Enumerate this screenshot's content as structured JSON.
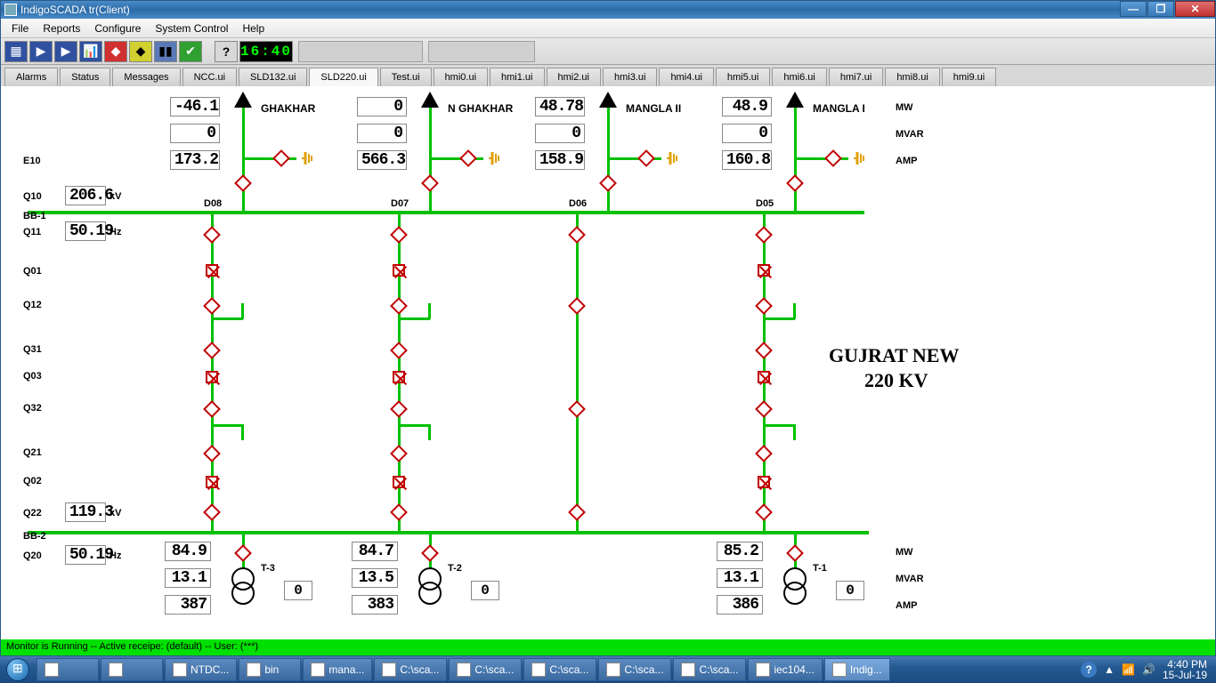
{
  "window": {
    "title": "IndigoSCADA tr(Client)"
  },
  "menu": [
    "File",
    "Reports",
    "Configure",
    "System Control",
    "Help"
  ],
  "toolbar": {
    "clock": "16:40"
  },
  "tabs": [
    "Alarms",
    "Status",
    "Messages",
    "NCC.ui",
    "SLD132.ui",
    "SLD220.ui",
    "Test.ui",
    "hmi0.ui",
    "hmi1.ui",
    "hmi2.ui",
    "hmi3.ui",
    "hmi4.ui",
    "hmi5.ui",
    "hmi6.ui",
    "hmi7.ui",
    "hmi8.ui",
    "hmi9.ui"
  ],
  "active_tab": "SLD220.ui",
  "feeders": [
    {
      "name": "GHAKHAR",
      "bay": "D08",
      "mw": "-46.1",
      "mvar": "0",
      "amp": "173.2"
    },
    {
      "name": "N GHAKHAR",
      "bay": "D07",
      "mw": "0",
      "mvar": "0",
      "amp": "566.3"
    },
    {
      "name": "MANGLA II",
      "bay": "D06",
      "mw": "48.78",
      "mvar": "0",
      "amp": "158.9"
    },
    {
      "name": "MANGLA I",
      "bay": "D05",
      "mw": "48.9",
      "mvar": "0",
      "amp": "160.8"
    }
  ],
  "bus1": {
    "label": "BB-1",
    "kv_lbl": "Q10",
    "kv": "206.6",
    "kv_u": "kV",
    "hz_lbl": "Q11",
    "hz": "50.19",
    "hz_u": "Hz",
    "e": "E10"
  },
  "bus2": {
    "label": "BB-2",
    "kv_lbl": "Q22",
    "kv": "119.3",
    "kv_u": "kV",
    "hz_lbl": "Q20",
    "hz": "50.19",
    "hz_u": "Hz"
  },
  "rows": [
    "Q01",
    "Q12",
    "Q31",
    "Q03",
    "Q32",
    "Q21",
    "Q02"
  ],
  "units_top": {
    "mw": "MW",
    "mvar": "MVAR",
    "amp": "AMP"
  },
  "units_bot": {
    "mw": "MW",
    "mvar": "MVAR",
    "amp": "AMP"
  },
  "title": {
    "l1": "GUJRAT NEW",
    "l2": "220 KV"
  },
  "trafos": [
    {
      "name": "T-3",
      "mw": "84.9",
      "mvar": "13.1",
      "amp": "387",
      "tap": "0"
    },
    {
      "name": "T-2",
      "mw": "84.7",
      "mvar": "13.5",
      "amp": "383",
      "tap": "0"
    },
    {
      "name": "T-1",
      "mw": "85.2",
      "mvar": "13.1",
      "amp": "386",
      "tap": "0"
    }
  ],
  "status": "Monitor is Running -- Active receipe: (default) -- User: (***)",
  "taskbar": {
    "items": [
      {
        "label": "",
        "icon": "ie"
      },
      {
        "label": "",
        "icon": "calc"
      },
      {
        "label": "NTDC...",
        "icon": "chrome"
      },
      {
        "label": "bin",
        "icon": "folder"
      },
      {
        "label": "mana...",
        "icon": "app"
      },
      {
        "label": "C:\\sca...",
        "icon": "app"
      },
      {
        "label": "C:\\sca...",
        "icon": "app"
      },
      {
        "label": "C:\\sca...",
        "icon": "app"
      },
      {
        "label": "C:\\sca...",
        "icon": "app"
      },
      {
        "label": "C:\\sca...",
        "icon": "app"
      },
      {
        "label": "iec104...",
        "icon": "app"
      },
      {
        "label": "Indig...",
        "icon": "indigo",
        "active": true
      }
    ],
    "time": "4:40 PM",
    "date": "15-Jul-19"
  }
}
